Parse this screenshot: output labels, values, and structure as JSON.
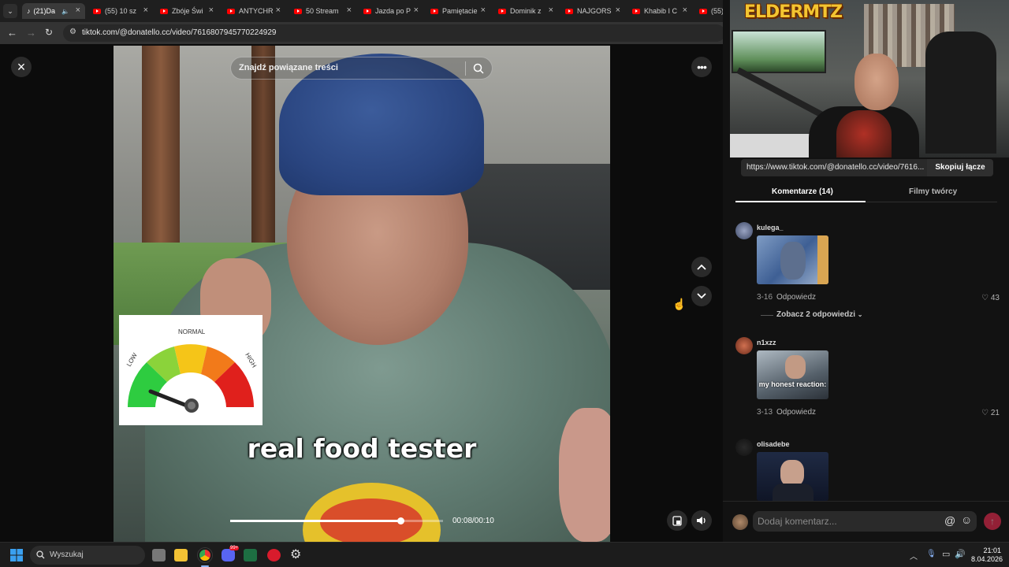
{
  "browser": {
    "tabs": [
      {
        "label": "(21)Da",
        "icon": "tiktok-icon",
        "active": true
      },
      {
        "label": "(55) 10 sz",
        "icon": "youtube-icon"
      },
      {
        "label": "Zbóje Świ",
        "icon": "youtube-icon"
      },
      {
        "label": "ANTYCHR",
        "icon": "youtube-icon"
      },
      {
        "label": "50 Stream",
        "icon": "youtube-icon"
      },
      {
        "label": "Jazda po P",
        "icon": "youtube-icon"
      },
      {
        "label": "Pamiętacie",
        "icon": "youtube-icon"
      },
      {
        "label": "Dominik z",
        "icon": "youtube-icon"
      },
      {
        "label": "NAJGORS",
        "icon": "youtube-icon"
      },
      {
        "label": "Khabib I C",
        "icon": "youtube-icon"
      },
      {
        "label": "(55) MF",
        "icon": "youtube-icon"
      }
    ],
    "url": "tiktok.com/@donatello.cc/video/7616807945770224929"
  },
  "video": {
    "search_placeholder": "Znajdź powiązane treści",
    "caption": "real food tester",
    "gauge": {
      "low": "LOW",
      "normal": "NORMAL",
      "high": "HIGH",
      "level": 0.1
    },
    "time": "00:08/00:10",
    "progress": 0.8
  },
  "webcam": {
    "logo": "ELDERMTZ"
  },
  "panel": {
    "share_link": "https://www.tiktok.com/@donatello.cc/video/7616...",
    "copy_label": "Skopiuj łącze",
    "tab_comments": "Komentarze (14)",
    "tab_creator": "Filmy twórcy",
    "comments": [
      {
        "user": "kulega_",
        "date": "3-16",
        "reply": "Odpowiedz",
        "likes": "43",
        "more": "Zobacz 2 odpowiedzi"
      },
      {
        "user": "n1xzz",
        "date": "3-13",
        "reply": "Odpowiedz",
        "likes": "21",
        "image_text": "my honest reaction:"
      },
      {
        "user": "olisadebe"
      }
    ],
    "comment_placeholder": "Dodaj komentarz..."
  },
  "taskbar": {
    "search": "Wyszukaj",
    "time": "21:01",
    "date": "8.04.2026",
    "discord_badge": "99+"
  },
  "colors": {
    "tiktok_red": "#fe2c55",
    "youtube_red": "#ff0000",
    "gauge_green": "#2ecc40",
    "gauge_yellow": "#f5c518",
    "gauge_orange": "#f27a1a",
    "gauge_red": "#e0201c"
  }
}
